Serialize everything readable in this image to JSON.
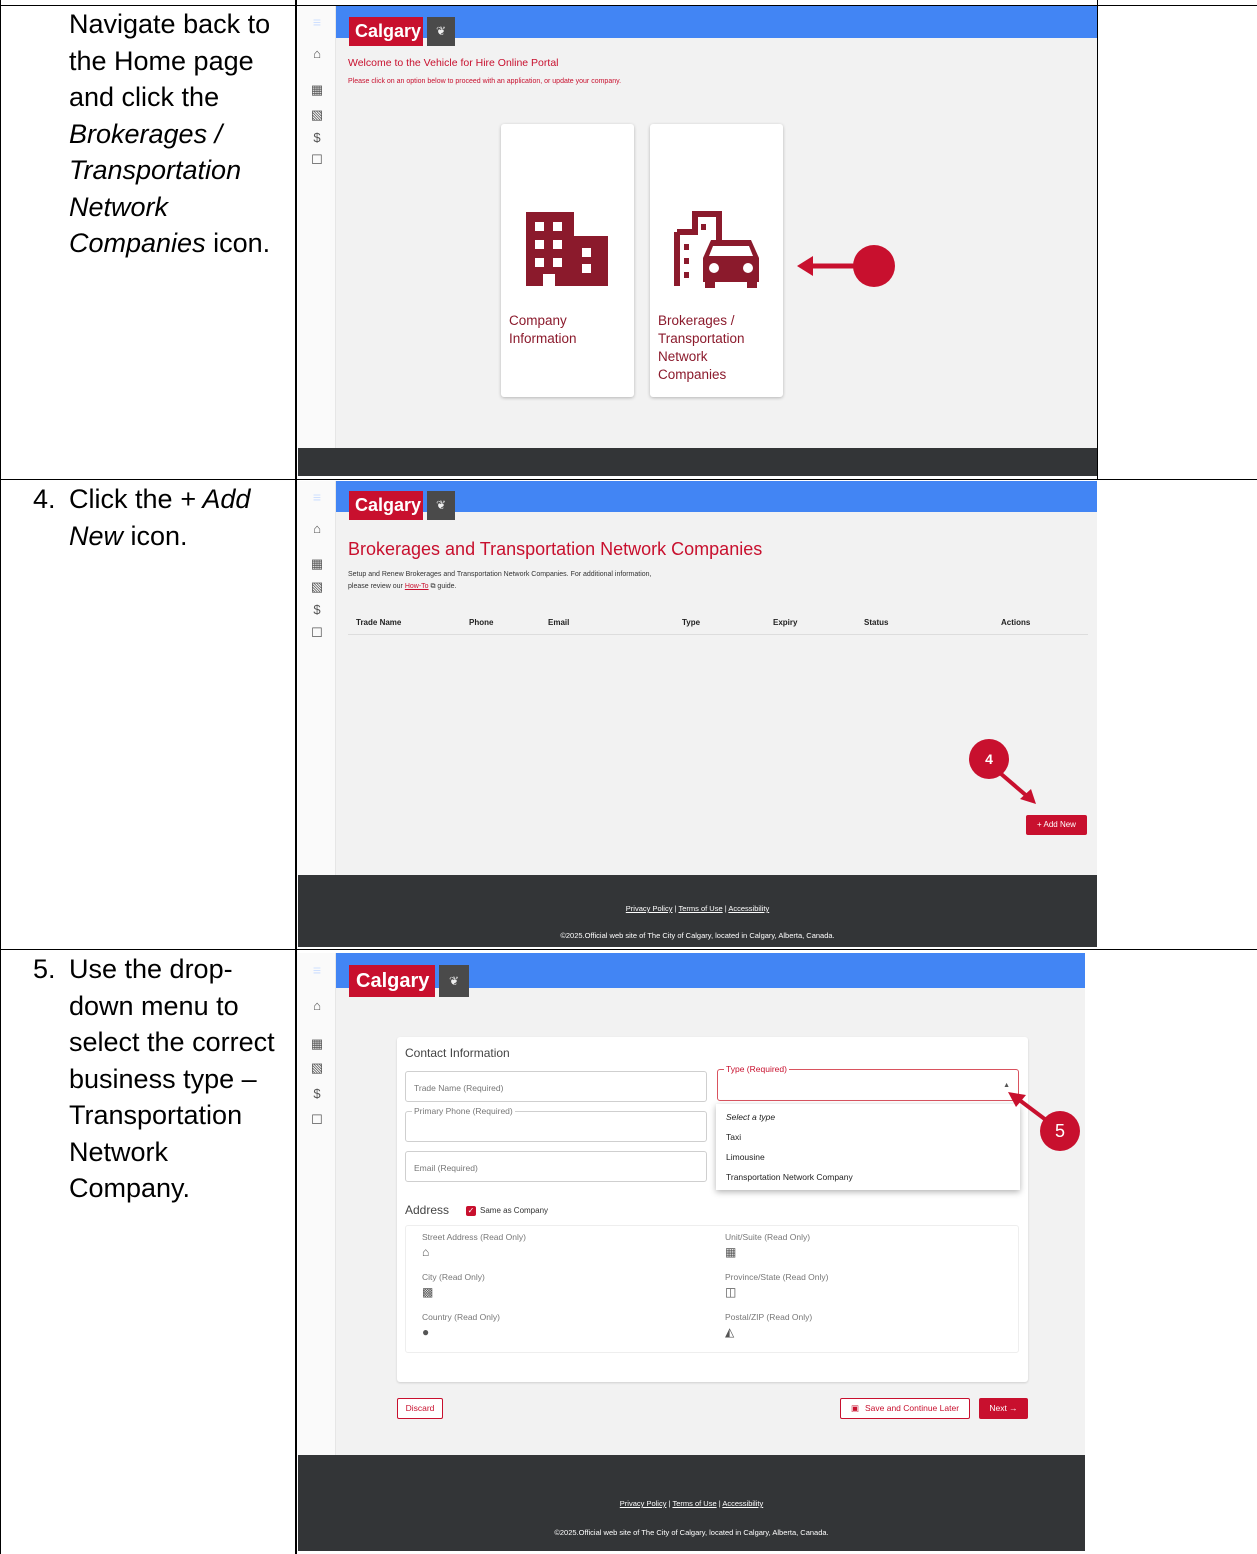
{
  "steps": {
    "s3": {
      "l1": "Navigate back to",
      "l2": "the Home page",
      "l3": "and click the",
      "l4": "Brokerages /",
      "l5": "Transportation",
      "l6": "Network",
      "l7": "Companies",
      "l7b": " icon."
    },
    "s4": {
      "num": "4.",
      "l1a": "Click the ",
      "l1b": "+ Add",
      "l2a": "New",
      "l2b": " icon."
    },
    "s5": {
      "num": "5.",
      "l1": "Use the drop-",
      "l2": "down menu to",
      "l3": "select the correct",
      "l4": "business type –",
      "l5": "Transportation",
      "l6": "Network",
      "l7": "Company."
    }
  },
  "brand": {
    "logo": "Calgary",
    "crest": "❦",
    "menu_icon": "≡",
    "accent": "#c8102e",
    "topbar": "#4285f4",
    "footer": "#333537"
  },
  "rail_icons": {
    "home": "⌂",
    "company": "▦",
    "brokerage": "▧",
    "fees": "$",
    "lock": "☐"
  },
  "home": {
    "welcome": "Welcome to the Vehicle for Hire Online Portal",
    "subtitle": "Please click on an option below to proceed with an application, or update your company.",
    "card1": {
      "l1": "Company",
      "l2": "Information"
    },
    "card2": {
      "l1": "Brokerages /",
      "l2": "Transportation",
      "l3": "Network",
      "l4": "Companies"
    }
  },
  "list": {
    "title": "Brokerages and Transportation Network Companies",
    "desc1": "Setup and Renew Brokerages and Transportation Network Companies. For additional information,",
    "desc2a": "please review our ",
    "desc2link": "How-To",
    "desc2b": " ⧉ guide.",
    "columns": [
      "Trade Name",
      "Phone",
      "Email",
      "Type",
      "Expiry",
      "Status",
      "Actions"
    ],
    "add_new": "+  Add New",
    "badge": "4"
  },
  "form": {
    "section": "Contact Information",
    "trade_name": "Trade Name (Required)",
    "type_label": "Type (Required)",
    "phone": "Primary Phone (Required)",
    "email": "Email (Required)",
    "options": [
      "Select a type",
      "Taxi",
      "Limousine",
      "Transportation Network Company"
    ],
    "address": "Address",
    "same_as": "Same as Company",
    "street": "Street Address (Read Only)",
    "unit": "Unit/Suite (Read Only)",
    "city": "City (Read Only)",
    "province": "Province/State (Read Only)",
    "country": "Country (Read Only)",
    "postal": "Postal/ZIP (Read Only)",
    "discard": "Discard",
    "save_later": "Save and Continue Later",
    "next": "Next →",
    "badge": "5"
  },
  "footer": {
    "privacy": "Privacy Policy",
    "terms": "Terms of Use",
    "access": "Accessibility",
    "sep": " | ",
    "copyright": "©2025.Official web site of The City of Calgary, located in Calgary, Alberta, Canada."
  }
}
